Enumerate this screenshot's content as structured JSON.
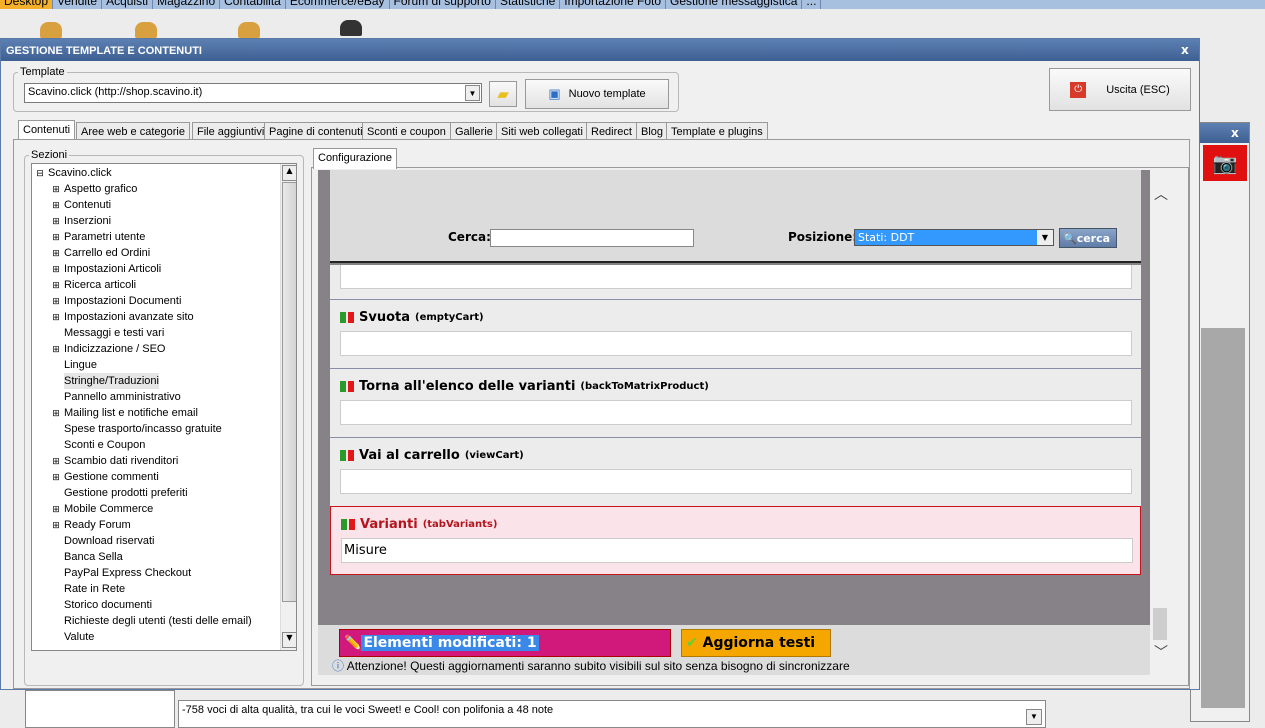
{
  "menubar": {
    "items": [
      "Desktop",
      "Vendite",
      "Acquisti",
      "Magazzino",
      "Contabilità",
      "Ecommerce/eBay",
      "Forum di supporto",
      "Statistiche",
      "Importazione Foto",
      "Gestione messaggistica",
      "..."
    ],
    "active": "Desktop"
  },
  "window": {
    "title": "GESTIONE TEMPLATE E CONTENUTI",
    "close": "x"
  },
  "template": {
    "legend": "Template",
    "selected": "Scavino.click (http://shop.scavino.it)",
    "new_button": "Nuovo template",
    "exit_button": "Uscita (ESC)"
  },
  "tabs": [
    "Contenuti",
    "Aree web e categorie",
    "File aggiuntivi",
    "Pagine di contenuti",
    "Sconti e coupon",
    "Gallerie",
    "Siti web collegati",
    "Redirect",
    "Blog",
    "Template e plugins"
  ],
  "sections": {
    "legend": "Sezioni",
    "root": "Scavino.click",
    "items": [
      {
        "label": "Aspetto grafico",
        "expandable": true
      },
      {
        "label": "Contenuti",
        "expandable": true
      },
      {
        "label": "Inserzioni",
        "expandable": true
      },
      {
        "label": "Parametri utente",
        "expandable": true
      },
      {
        "label": "Carrello ed Ordini",
        "expandable": true
      },
      {
        "label": "Impostazioni Articoli",
        "expandable": true
      },
      {
        "label": "Ricerca articoli",
        "expandable": true
      },
      {
        "label": "Impostazioni Documenti",
        "expandable": true
      },
      {
        "label": "Impostazioni avanzate sito",
        "expandable": true
      },
      {
        "label": "Messaggi e testi vari",
        "expandable": false
      },
      {
        "label": "Indicizzazione / SEO",
        "expandable": true
      },
      {
        "label": "Lingue",
        "expandable": false
      },
      {
        "label": "Stringhe/Traduzioni",
        "expandable": false,
        "selected": true
      },
      {
        "label": "Pannello amministrativo",
        "expandable": false
      },
      {
        "label": "Mailing list e notifiche email",
        "expandable": true
      },
      {
        "label": "Spese trasporto/incasso gratuite",
        "expandable": false
      },
      {
        "label": "Sconti e Coupon",
        "expandable": false
      },
      {
        "label": "Scambio dati rivenditori",
        "expandable": true
      },
      {
        "label": "Gestione commenti",
        "expandable": true
      },
      {
        "label": "Gestione prodotti preferiti",
        "expandable": false
      },
      {
        "label": "Mobile Commerce",
        "expandable": true
      },
      {
        "label": "Ready Forum",
        "expandable": true
      },
      {
        "label": "Download riservati",
        "expandable": false
      },
      {
        "label": "Banca Sella",
        "expandable": false
      },
      {
        "label": "PayPal Express Checkout",
        "expandable": false
      },
      {
        "label": "Rate in Rete",
        "expandable": false
      },
      {
        "label": "Storico documenti",
        "expandable": false
      },
      {
        "label": "Richieste degli utenti (testi delle email)",
        "expandable": false
      },
      {
        "label": "Valute",
        "expandable": false
      }
    ]
  },
  "config": {
    "tab": "Configurazione",
    "search_label": "Cerca:",
    "search_value": "",
    "position_label": "Posizione:",
    "position_value": "Stati: DDT",
    "search_button": "cerca",
    "rows": [
      {
        "label": "Svuota",
        "key": "(emptyCart)",
        "value": "",
        "modified": false
      },
      {
        "label": "Torna all'elenco delle varianti",
        "key": "(backToMatrixProduct)",
        "value": "",
        "modified": false
      },
      {
        "label": "Vai al carrello",
        "key": "(viewCart)",
        "value": "",
        "modified": false
      },
      {
        "label": "Varianti",
        "key": "(tabVariants)",
        "value": "Misure",
        "modified": true
      }
    ]
  },
  "footer": {
    "modified": "Elementi modificati: 1",
    "update_button": "Aggiorna testi",
    "warning": "Attenzione! Questi aggiornamenti saranno subito visibili sul sito senza bisogno di sincronizzare"
  },
  "background": {
    "description_text": "-758 voci di alta qualità, tra cui le voci Sweet! e Cool! con polifonia a 48 note",
    "close": "x"
  },
  "colors": {
    "titlebar": "#4d6f9e",
    "modified_bg": "#d0197a",
    "update_bg": "#f5a700",
    "modified_row": "#fbe3ea"
  }
}
